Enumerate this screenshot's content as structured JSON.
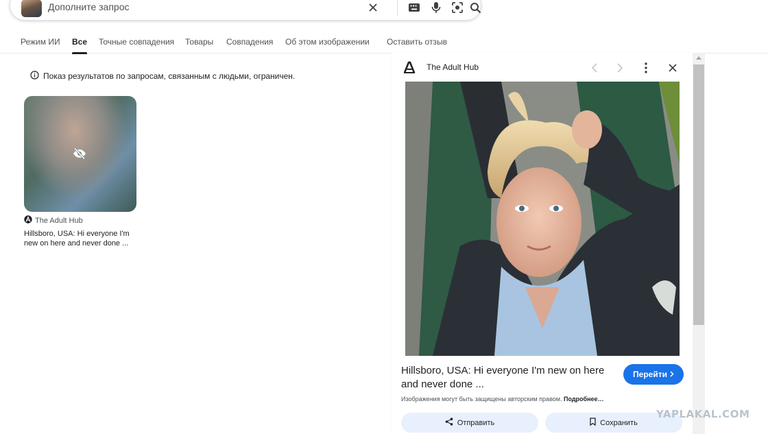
{
  "search": {
    "placeholder": "Дополните запрос"
  },
  "tabs": [
    {
      "label": "Режим ИИ"
    },
    {
      "label": "Все"
    },
    {
      "label": "Точные совпадения"
    },
    {
      "label": "Товары"
    },
    {
      "label": "Совпадения"
    },
    {
      "label": "Об этом изображении"
    },
    {
      "label": "Оставить отзыв"
    }
  ],
  "active_tab": "Все",
  "notice": {
    "text": "Показ результатов по запросам, связанным с людьми, ограничен."
  },
  "result": {
    "source": "The Adult Hub",
    "title": "Hillsboro, USA: Hi everyone I'm new on here and never done ..."
  },
  "panel": {
    "source": "The Adult Hub",
    "title": "Hillsboro, USA: Hi everyone I'm new on here and never done ...",
    "visit_label": "Перейти",
    "copyright_text": "Изображения могут быть защищены авторским правом.",
    "more_label": "Подробнее…",
    "share_label": "Отправить",
    "save_label": "Сохранить"
  },
  "watermark": "YAPLAKAL.COM",
  "icons": {
    "clear": "close-icon",
    "keyboard": "keyboard-icon",
    "voice": "mic-icon",
    "lens": "lens-icon",
    "search": "search-icon",
    "info": "info-icon",
    "hidden": "eye-off-icon",
    "prev": "chevron-left-icon",
    "next": "chevron-right-icon",
    "more": "more-vert-icon",
    "close": "close-icon",
    "share": "share-icon",
    "bookmark": "bookmark-icon"
  },
  "colors": {
    "accent": "#1a73e8",
    "button_bg": "#e8f0fe"
  }
}
